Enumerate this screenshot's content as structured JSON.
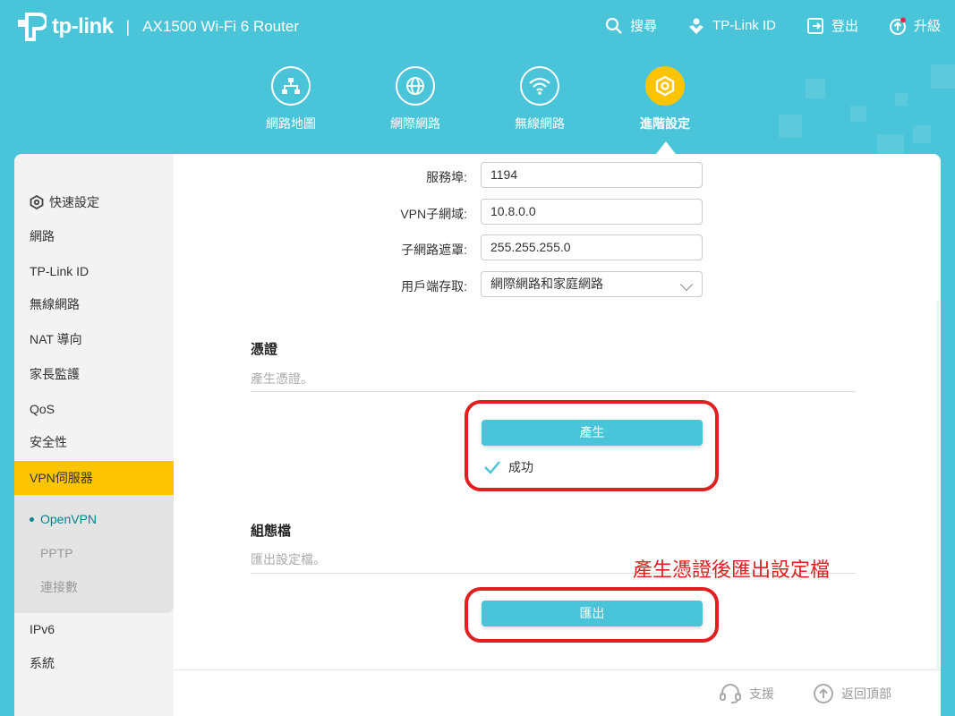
{
  "header": {
    "brand": "tp-link",
    "separator": "|",
    "model": "AX1500 Wi-Fi 6 Router",
    "actions": {
      "search": "搜尋",
      "tplink_id": "TP-Link ID",
      "logout": "登出",
      "upgrade": "升級"
    }
  },
  "main_nav": {
    "network_map": "網路地圖",
    "internet": "網際網路",
    "wireless": "無線網路",
    "advanced": "進階設定"
  },
  "sidebar": {
    "quick_setup": "快速設定",
    "network": "網路",
    "tplink_id": "TP-Link ID",
    "wireless": "無線網路",
    "nat": "NAT 導向",
    "parental": "家長監護",
    "qos": "QoS",
    "security": "安全性",
    "vpn": "VPN伺服器",
    "openvpn": "OpenVPN",
    "pptp": "PPTP",
    "connections": "連接數",
    "ipv6": "IPv6",
    "system": "系統"
  },
  "form": {
    "port_label": "服務埠:",
    "port_value": "1194",
    "subnet_label": "VPN子網域:",
    "subnet_value": "10.8.0.0",
    "mask_label": "子網路遮罩:",
    "mask_value": "255.255.255.0",
    "access_label": "用戶端存取:",
    "access_value": "網際網路和家庭網路"
  },
  "certificate": {
    "title": "憑證",
    "desc": "產生憑證。",
    "button": "產生",
    "status": "成功"
  },
  "config": {
    "title": "組態檔",
    "desc": "匯出設定檔。",
    "button": "匯出"
  },
  "annotation": "產生憑證後匯出設定檔",
  "footer": {
    "support": "支援",
    "back_top": "返回頂部"
  },
  "colors": {
    "teal": "#4ac4d9",
    "yellow": "#ffc400",
    "red_annotation": "#e02020"
  }
}
